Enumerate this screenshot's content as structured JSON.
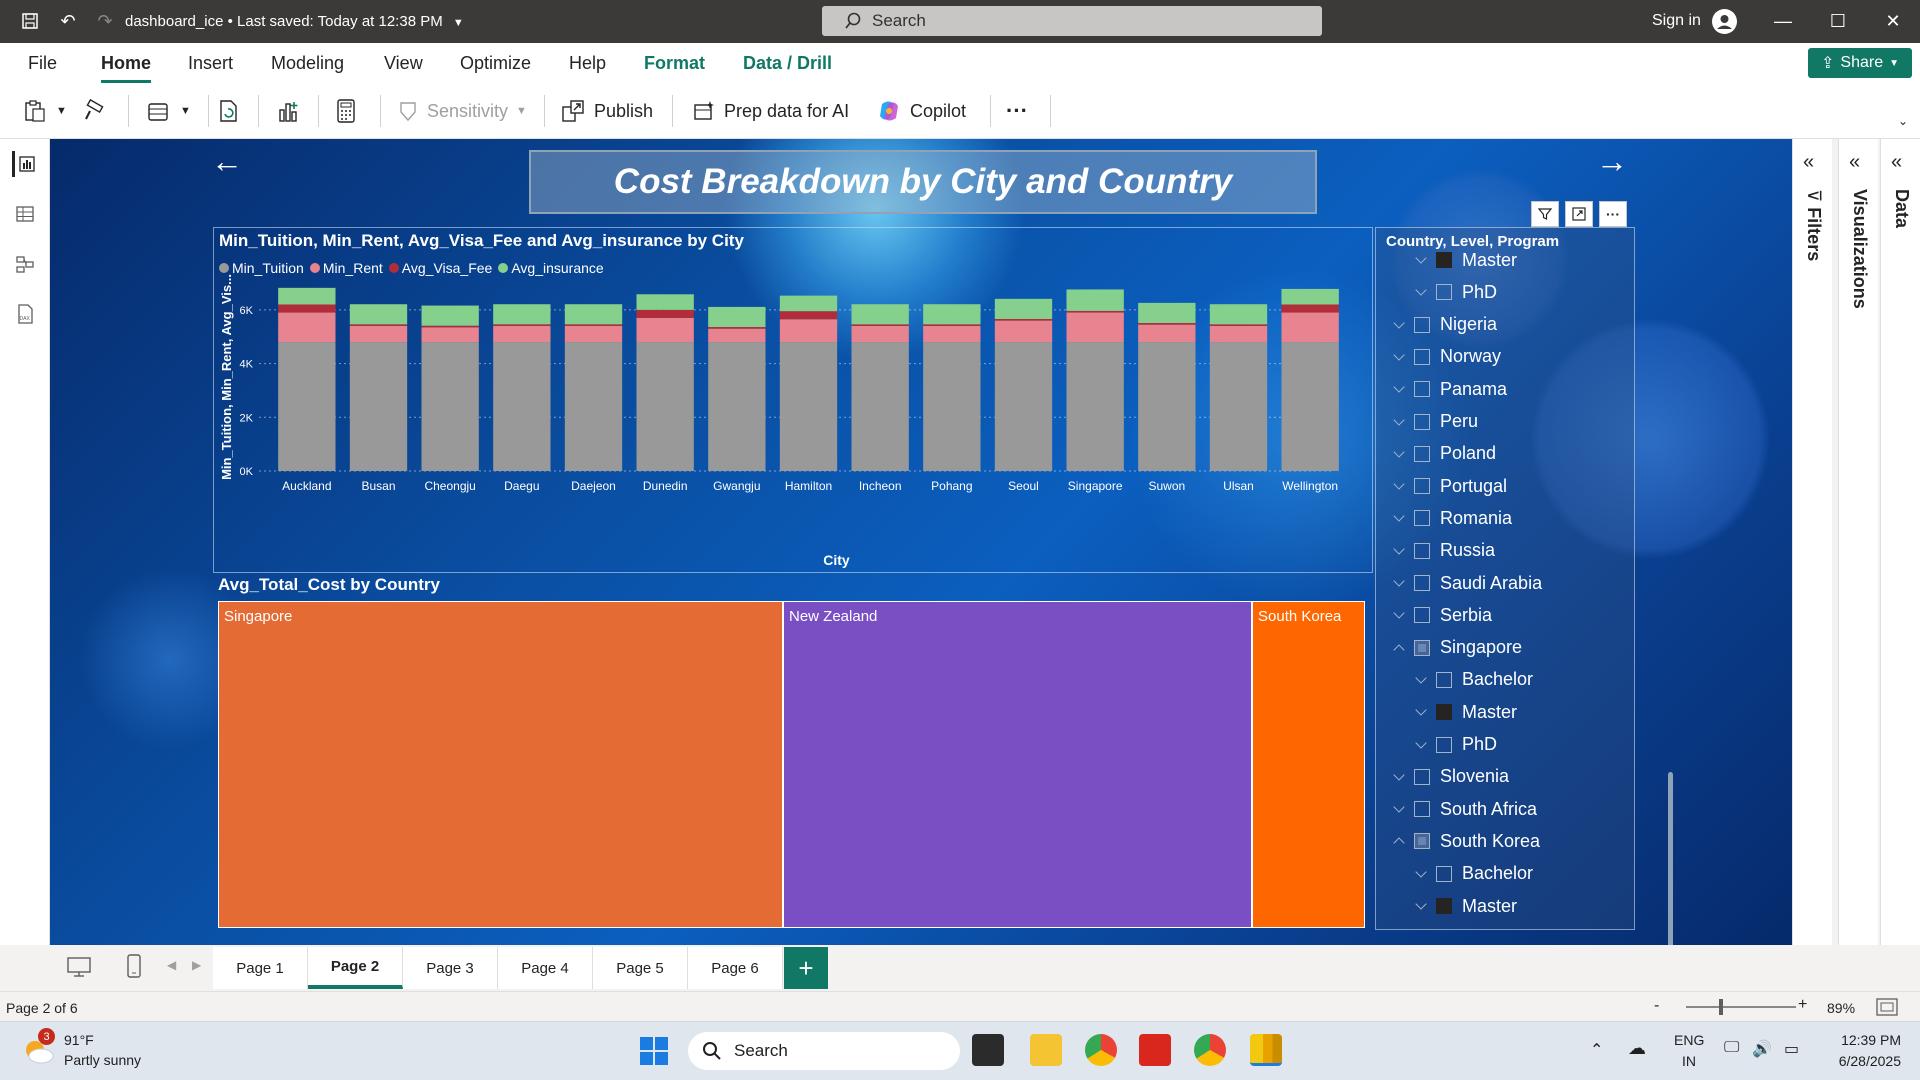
{
  "titlebar": {
    "file_name": "dashboard_ice",
    "save_status": "Last saved: Today at 12:38 PM",
    "search_placeholder": "Search",
    "sign_in": "Sign in"
  },
  "ribbon": {
    "tabs": [
      "File",
      "Home",
      "Insert",
      "Modeling",
      "View",
      "Optimize",
      "Help",
      "Format",
      "Data / Drill"
    ],
    "active_tab": "Home",
    "share_label": "Share"
  },
  "toolbar": {
    "sensitivity": "Sensitivity",
    "publish": "Publish",
    "prep_data": "Prep data for AI",
    "copilot": "Copilot",
    "more": "···"
  },
  "report": {
    "page_title": "Cost Breakdown by City and Country"
  },
  "bar_chart": {
    "title": "Min_Tuition, Min_Rent, Avg_Visa_Fee and Avg_insurance by City",
    "legend": [
      "Min_Tuition",
      "Min_Rent",
      "Avg_Visa_Fee",
      "Avg_insurance"
    ],
    "x_axis_label": "City",
    "y_axis_label": "Min_Tuition, Min_Rent, Avg_Vis...",
    "y_ticks": [
      "0K",
      "2K",
      "4K",
      "6K"
    ]
  },
  "chart_data": {
    "type": "bar",
    "stacked": true,
    "title": "Min_Tuition, Min_Rent, Avg_Visa_Fee and Avg_insurance by City",
    "xlabel": "City",
    "ylabel": "Min_Tuition, Min_Rent, Avg_Vis...",
    "ylim": [
      0,
      7000
    ],
    "grid": true,
    "legend_position": "top-left",
    "categories": [
      "Auckland",
      "Busan",
      "Cheongju",
      "Daegu",
      "Daejeon",
      "Dunedin",
      "Gwangju",
      "Hamilton",
      "Incheon",
      "Pohang",
      "Seoul",
      "Singapore",
      "Suwon",
      "Ulsan",
      "Wellington"
    ],
    "series": [
      {
        "name": "Min_Tuition",
        "color": "#999999",
        "values": [
          4800,
          4800,
          4800,
          4800,
          4800,
          4800,
          4800,
          4800,
          4800,
          4800,
          4800,
          4800,
          4800,
          4800,
          4800
        ]
      },
      {
        "name": "Min_Rent",
        "color": "#e8848f",
        "values": [
          1100,
          600,
          550,
          600,
          600,
          900,
          500,
          850,
          600,
          600,
          800,
          1100,
          650,
          600,
          1100
        ]
      },
      {
        "name": "Avg_Visa_Fee",
        "color": "#b22d3a",
        "values": [
          300,
          60,
          60,
          60,
          60,
          300,
          60,
          300,
          60,
          60,
          60,
          60,
          60,
          60,
          300
        ]
      },
      {
        "name": "Avg_insurance",
        "color": "#86d08e",
        "values": [
          620,
          750,
          750,
          750,
          750,
          580,
          750,
          580,
          750,
          750,
          750,
          800,
          750,
          750,
          580
        ]
      }
    ]
  },
  "treemap": {
    "title": "Avg_Total_Cost by Country",
    "items": [
      {
        "label": "Singapore",
        "color": "#e56b35"
      },
      {
        "label": "New Zealand",
        "color": "#7a4fc4"
      },
      {
        "label": "South Korea",
        "color": "#fe6600"
      }
    ]
  },
  "slicer": {
    "header": "Country, Level, Program",
    "items": [
      {
        "label": "Master",
        "level": 2,
        "state": "checked",
        "chevron": "down"
      },
      {
        "label": "PhD",
        "level": 2,
        "state": "empty",
        "chevron": "down"
      },
      {
        "label": "Nigeria",
        "level": 1,
        "state": "empty",
        "chevron": "down"
      },
      {
        "label": "Norway",
        "level": 1,
        "state": "empty",
        "chevron": "down"
      },
      {
        "label": "Panama",
        "level": 1,
        "state": "empty",
        "chevron": "down"
      },
      {
        "label": "Peru",
        "level": 1,
        "state": "empty",
        "chevron": "down"
      },
      {
        "label": "Poland",
        "level": 1,
        "state": "empty",
        "chevron": "down"
      },
      {
        "label": "Portugal",
        "level": 1,
        "state": "empty",
        "chevron": "down"
      },
      {
        "label": "Romania",
        "level": 1,
        "state": "empty",
        "chevron": "down"
      },
      {
        "label": "Russia",
        "level": 1,
        "state": "empty",
        "chevron": "down"
      },
      {
        "label": "Saudi Arabia",
        "level": 1,
        "state": "empty",
        "chevron": "down"
      },
      {
        "label": "Serbia",
        "level": 1,
        "state": "empty",
        "chevron": "down"
      },
      {
        "label": "Singapore",
        "level": 1,
        "state": "partial",
        "chevron": "up"
      },
      {
        "label": "Bachelor",
        "level": 2,
        "state": "empty",
        "chevron": "down"
      },
      {
        "label": "Master",
        "level": 2,
        "state": "checked",
        "chevron": "down"
      },
      {
        "label": "PhD",
        "level": 2,
        "state": "empty",
        "chevron": "down"
      },
      {
        "label": "Slovenia",
        "level": 1,
        "state": "empty",
        "chevron": "down"
      },
      {
        "label": "South Africa",
        "level": 1,
        "state": "empty",
        "chevron": "down"
      },
      {
        "label": "South Korea",
        "level": 1,
        "state": "partial",
        "chevron": "up"
      },
      {
        "label": "Bachelor",
        "level": 2,
        "state": "empty",
        "chevron": "down"
      },
      {
        "label": "Master",
        "level": 2,
        "state": "checked",
        "chevron": "down"
      }
    ]
  },
  "panes": {
    "filters": "Filters",
    "visualizations": "Visualizations",
    "data": "Data"
  },
  "pages": [
    "Page 1",
    "Page 2",
    "Page 3",
    "Page 4",
    "Page 5",
    "Page 6"
  ],
  "active_page": "Page 2",
  "statusbar": {
    "page_status": "Page 2 of 6",
    "zoom": "89%",
    "zoom_minus": "-",
    "zoom_plus": "+"
  },
  "taskbar": {
    "weather_temp": "91°F",
    "weather_desc": "Partly sunny",
    "weather_badge": "3",
    "search": "Search",
    "lang1": "ENG",
    "lang2": "IN",
    "time": "12:39 PM",
    "date": "6/28/2025"
  }
}
